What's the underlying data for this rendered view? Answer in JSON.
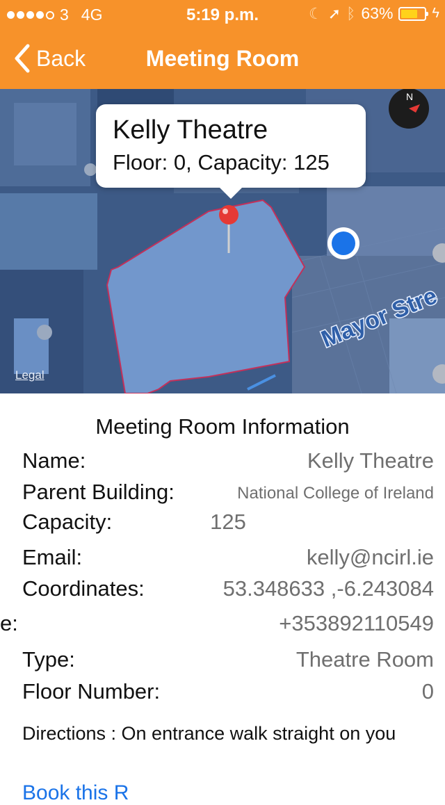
{
  "status_bar": {
    "carrier": "3",
    "network": "4G",
    "time": "5:19 p.m.",
    "battery": "63%",
    "battery_level": 0.63
  },
  "nav": {
    "back_label": "Back",
    "title": "Meeting Room"
  },
  "map": {
    "callout_title": "Kelly Theatre",
    "callout_subtitle": "Floor: 0, Capacity: 125",
    "street_label": "Mayor Stre",
    "legal": "Legal"
  },
  "info": {
    "section_title": "Meeting Room Information",
    "name_label": "Name:",
    "name_value": "Kelly Theatre",
    "parent_label": "Parent Building:",
    "parent_value": "National College of Ireland",
    "capacity_label": "Capacity:",
    "capacity_value": "125",
    "email_label": "Email:",
    "email_value": "kelly@ncirl.ie",
    "coords_label": "Coordinates:",
    "coords_value": "53.348633 ,-6.243084",
    "phone_label": "e:",
    "phone_value": "+353892110549",
    "type_label": "Type:",
    "type_value": "Theatre Room",
    "floor_label": "Floor Number:",
    "floor_value": "0",
    "directions": "Directions : On entrance walk straight on you",
    "book_label": "Book this R"
  },
  "colors": {
    "accent": "#f7922a",
    "link": "#1a73e8",
    "location_dot": "#1a73e8",
    "pin": "#e53935"
  }
}
